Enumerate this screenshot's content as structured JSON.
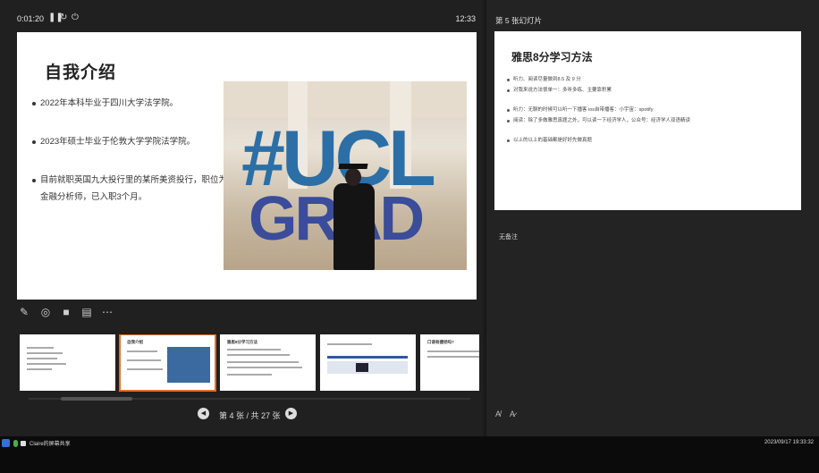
{
  "topbar": {
    "elapsed": "0:01:20",
    "pause_icon": "pause-icon",
    "restart_icon": "restart-icon",
    "end_icon": "power-icon",
    "clock": "12:33"
  },
  "slide": {
    "title": "自我介绍",
    "bullets": [
      "2022年本科毕业于四川大学法学院。",
      "2023年硕士毕业于伦敦大学学院法学院。",
      "目前就职英国九大投行里的某所美资投行，职位为金融分析师，已入职3个月。"
    ],
    "photo_text_1": "#UCL",
    "photo_text_2": "GRAD"
  },
  "tools": [
    "pen-icon",
    "laser-pointer-icon",
    "camera-icon",
    "subtitles-icon",
    "more-icon"
  ],
  "thumbnails": [
    {
      "title": "",
      "active": false
    },
    {
      "title": "自我介绍",
      "active": true
    },
    {
      "title": "雅思8分学习方法",
      "active": false
    },
    {
      "title": "",
      "active": false
    },
    {
      "title": "口语有捷径吗?",
      "active": false
    }
  ],
  "pager": {
    "text": "第 4 张 / 共 27 张",
    "prev_icon": "prev-icon",
    "next_icon": "next-icon"
  },
  "next": {
    "label": "第 5 张幻灯片",
    "title": "雅思8分学习方法",
    "items_a": [
      "听力、阅读尽量做到8.5 及 9 分",
      "对我来说方法很单一：多听多练、主要靠积累"
    ],
    "items_b": [
      "听力：无聊的时候可以听一下播客 ios自带播客：小宇宙：spotify",
      "阅读：除了多做雅思真题之外，可以读一下经济学人，公众号：经济学人双语精读"
    ],
    "items_c": [
      "以上的以上的基础都是好好先做真题"
    ]
  },
  "notes": {
    "label": "无备注"
  },
  "taskbar": {
    "user": "Claire的屏幕共享",
    "datetime": "2023/09/17 19:33:32"
  }
}
